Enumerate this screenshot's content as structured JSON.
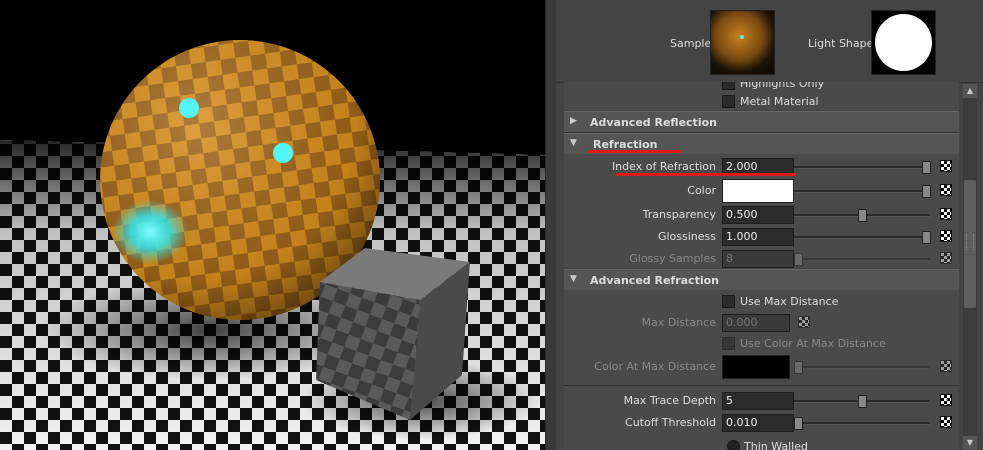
{
  "swatches": {
    "sample_label": "Sample",
    "light_shape_label": "Light Shape"
  },
  "top_partial": {
    "highlights_only": "Highlights Only",
    "metal_material": "Metal Material"
  },
  "sections": {
    "advanced_reflection": "Advanced Reflection",
    "refraction": "Refraction",
    "advanced_refraction": "Advanced Refraction"
  },
  "refraction": {
    "ior_label": "Index of Refraction",
    "ior_value": "2.000",
    "ior_slider": 1.0,
    "color_label": "Color",
    "color_value": "#ffffff",
    "color_slider": 1.0,
    "transparency_label": "Transparency",
    "transparency_value": "0.500",
    "transparency_slider": 0.5,
    "glossiness_label": "Glossiness",
    "glossiness_value": "1.000",
    "glossiness_slider": 1.0,
    "glossy_samples_label": "Glossy Samples",
    "glossy_samples_value": "8",
    "glossy_samples_slider": 0.0
  },
  "advanced_refraction": {
    "use_max_distance": "Use Max Distance",
    "max_distance_label": "Max Distance",
    "max_distance_value": "0.000",
    "use_color_at_max": "Use Color At Max Distance",
    "color_at_max_label": "Color At Max Distance",
    "color_at_max_value": "#000000",
    "color_at_max_slider": 0.0,
    "max_trace_depth_label": "Max Trace Depth",
    "max_trace_depth_value": "5",
    "max_trace_depth_slider": 0.5,
    "cutoff_threshold_label": "Cutoff Threshold",
    "cutoff_threshold_value": "0.010",
    "cutoff_threshold_slider": 0.0,
    "thin_walled": "Thin Walled"
  },
  "icons": {
    "expanded": "▼",
    "collapsed": "▶",
    "scroll_up": "▲",
    "scroll_down": "▼"
  },
  "colors": {
    "annotation_red": "#e01818",
    "sphere_orange": "#d88a1c",
    "highlight_cyan": "#3ff2f2"
  }
}
